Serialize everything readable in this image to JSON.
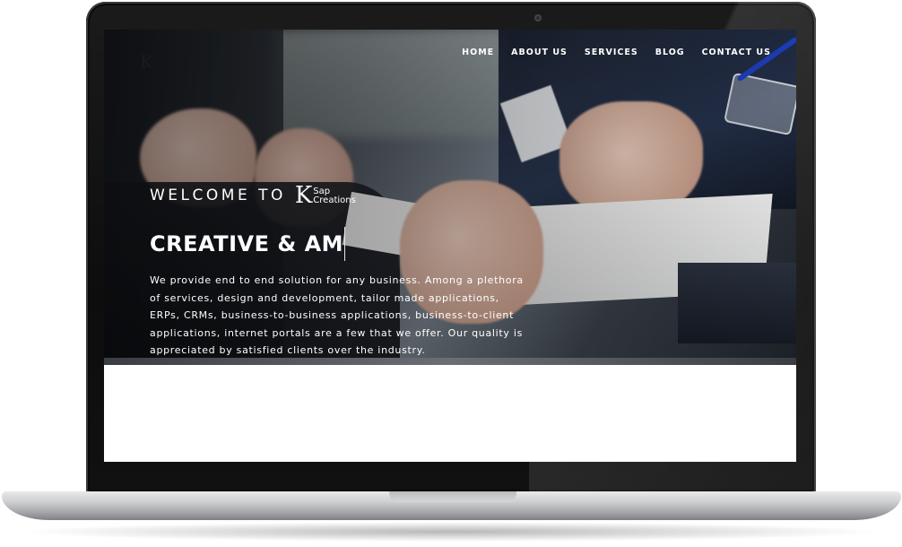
{
  "nav": {
    "items": [
      {
        "label": "HOME"
      },
      {
        "label": "ABOUT US"
      },
      {
        "label": "SERVICES"
      },
      {
        "label": "BLOG"
      },
      {
        "label": "CONTACT US"
      }
    ]
  },
  "header": {
    "logo_mark": "K"
  },
  "hero": {
    "welcome": "WELCOME TO",
    "brand": {
      "mark": "K",
      "line1": "Sap",
      "line2": "Creations"
    },
    "headline": "CREATIVE & AM",
    "description": "We provide end to end solution for any business. Among a plethora of services, design and development, tailor made applications, ERPs, CRMs, business-to-business applications, business-to-client applications, internet portals are a few that we offer. Our quality is appreciated by satisfied clients over the industry."
  },
  "colors": {
    "nav_text": "#ffffff",
    "hero_text": "#ffffff",
    "screen_bg": "#ffffff",
    "accent_pen": "#1d3fbf"
  },
  "icons": {
    "camera": "camera-icon"
  }
}
